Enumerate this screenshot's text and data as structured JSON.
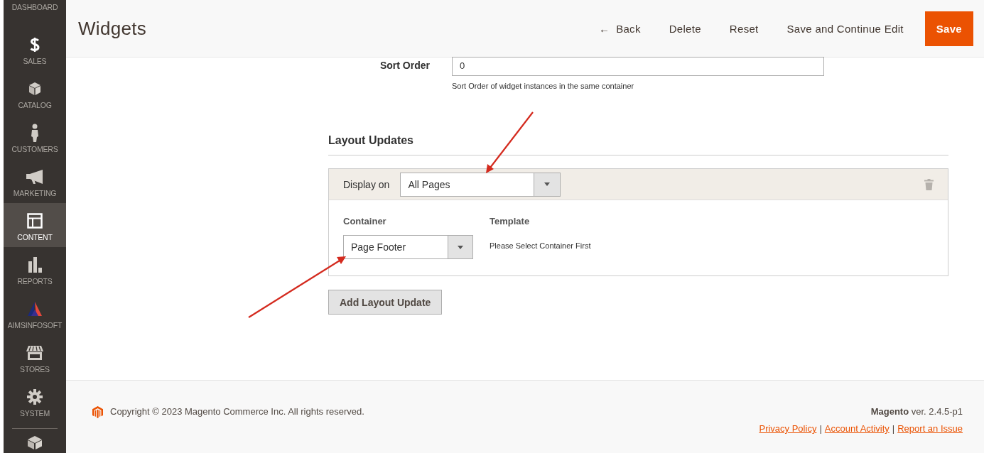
{
  "sidebar": {
    "items": [
      {
        "label": "DASHBOARD",
        "selected": false
      },
      {
        "label": "SALES",
        "selected": false
      },
      {
        "label": "CATALOG",
        "selected": false
      },
      {
        "label": "CUSTOMERS",
        "selected": false
      },
      {
        "label": "MARKETING",
        "selected": false
      },
      {
        "label": "CONTENT",
        "selected": true
      },
      {
        "label": "REPORTS",
        "selected": false
      },
      {
        "label": "AIMSINFOSOFT",
        "selected": false
      },
      {
        "label": "STORES",
        "selected": false
      },
      {
        "label": "SYSTEM",
        "selected": false
      },
      {
        "selected": false
      }
    ]
  },
  "header": {
    "title": "Widgets",
    "actions": [
      {
        "kind": "back",
        "arrow": "←",
        "label": "Back"
      },
      {
        "kind": "plain",
        "label": "Delete"
      },
      {
        "kind": "plain",
        "label": "Reset"
      },
      {
        "kind": "plain",
        "label": "Save and Continue Edit"
      },
      {
        "kind": "primary",
        "label": "Save"
      }
    ]
  },
  "sort_order": {
    "label": "Sort Order",
    "value": "0",
    "note": "Sort Order of widget instances in the same container"
  },
  "layout_updates": {
    "title": "Layout Updates",
    "display_on": {
      "label": "Display on",
      "value": "All Pages"
    },
    "container": {
      "label": "Container",
      "value": "Page Footer"
    },
    "template": {
      "label": "Template",
      "message": "Please Select Container First"
    },
    "add_button": "Add Layout Update"
  },
  "footer": {
    "copyright": "Copyright © 2023 Magento Commerce Inc. All rights reserved.",
    "brand": "Magento",
    "version": "ver. 2.4.5-p1",
    "links": [
      {
        "kind": "link",
        "text": "Privacy Policy"
      },
      {
        "kind": "separator",
        "text": "|"
      },
      {
        "kind": "link",
        "text": "Account Activity"
      },
      {
        "kind": "separator",
        "text": "|"
      },
      {
        "kind": "link",
        "text": "Report an Issue"
      }
    ]
  }
}
